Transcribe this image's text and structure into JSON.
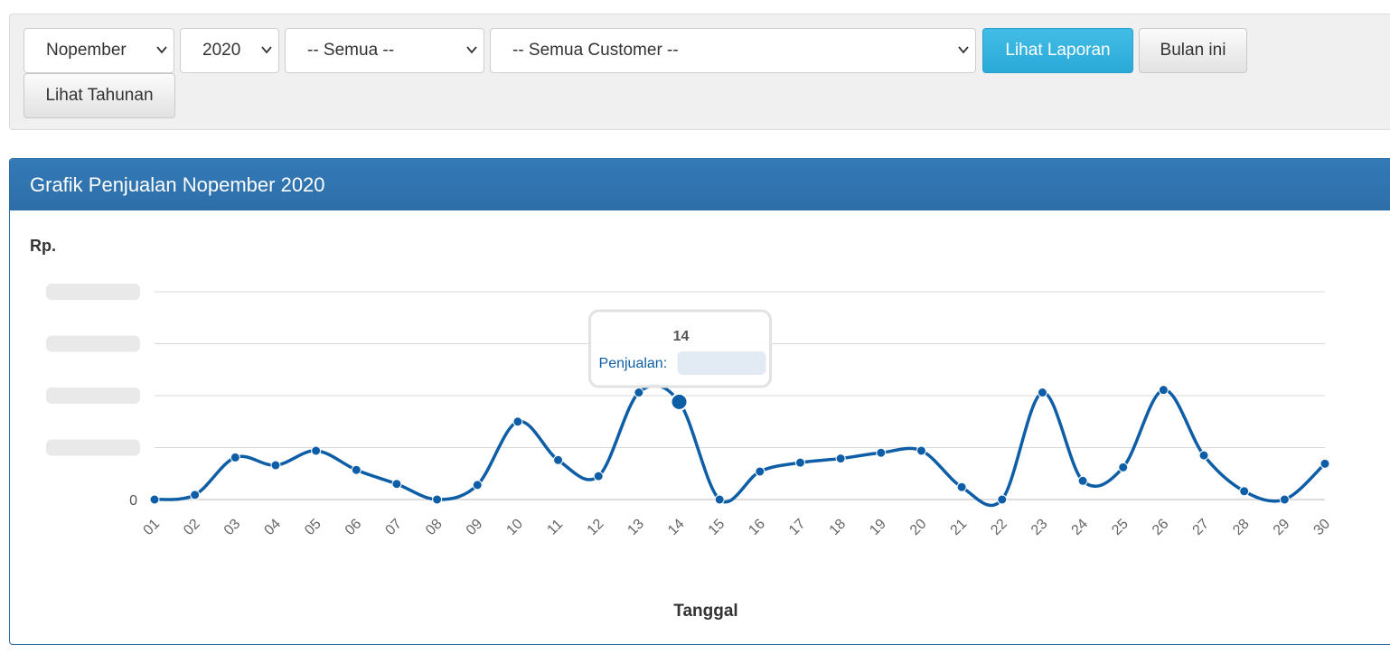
{
  "filters": {
    "month": "Nopember",
    "year": "2020",
    "category": "-- Semua --",
    "customer": "-- Semua Customer --"
  },
  "buttons": {
    "view_report": "Lihat Laporan",
    "this_month": "Bulan ini",
    "view_yearly": "Lihat Tahunan"
  },
  "panel": {
    "title": "Grafik Penjualan Nopember 2020"
  },
  "colors": {
    "series": "#0d5ea6",
    "heading": "#337ab7",
    "primary_button": "#2aa9d7"
  },
  "tooltip": {
    "title": "14",
    "label": "Penjualan:",
    "value_redacted": true
  },
  "chart_data": {
    "type": "line",
    "ylabel": "Rp.",
    "xlabel": "Tanggal",
    "y_tick_labels_visible": [
      "0"
    ],
    "y_gridlines": 5,
    "y_values_relative": true,
    "ylim": [
      0,
      4
    ],
    "categories": [
      "01",
      "02",
      "03",
      "04",
      "05",
      "06",
      "07",
      "08",
      "09",
      "10",
      "11",
      "12",
      "13",
      "14",
      "15",
      "16",
      "17",
      "18",
      "19",
      "20",
      "21",
      "22",
      "23",
      "24",
      "25",
      "26",
      "27",
      "28",
      "29",
      "30"
    ],
    "series": [
      {
        "name": "Penjualan",
        "values": [
          0.0,
          0.09,
          0.81,
          0.66,
          0.94,
          0.57,
          0.3,
          0.0,
          0.28,
          1.5,
          0.76,
          0.45,
          2.06,
          1.88,
          0.0,
          0.54,
          0.71,
          0.79,
          0.9,
          0.94,
          0.24,
          0.0,
          2.06,
          0.36,
          0.62,
          2.11,
          0.85,
          0.16,
          0.0,
          0.69
        ]
      }
    ],
    "highlighted_point": "14",
    "grid": true
  }
}
